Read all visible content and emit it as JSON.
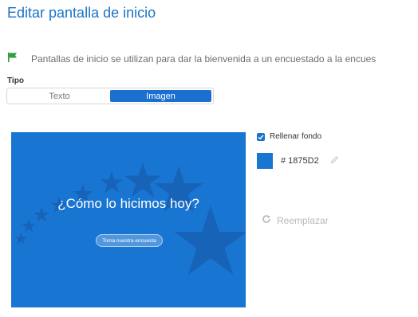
{
  "header": {
    "title": "Editar pantalla de inicio"
  },
  "info": {
    "icon": "flag-icon",
    "text": "Pantallas de inicio se utilizan para dar la bienvenida a un encuestado a la encues"
  },
  "type_selector": {
    "label": "Tipo",
    "options": [
      "Texto",
      "Imagen"
    ],
    "selected": "Imagen"
  },
  "preview": {
    "background_color": "#1875D2",
    "title": "¿Cómo lo hicimos hoy?",
    "button_label": "Toma nuestra encuesta"
  },
  "background": {
    "fill_label": "Rellenar fondo",
    "fill_checked": true,
    "color_hex": "# 1875D2",
    "color": "#1875D2"
  },
  "replace": {
    "label": "Reemplazar",
    "icon": "refresh-icon",
    "enabled": false
  },
  "colors": {
    "accent": "#1a73c8",
    "flag": "#2e9e3e"
  }
}
